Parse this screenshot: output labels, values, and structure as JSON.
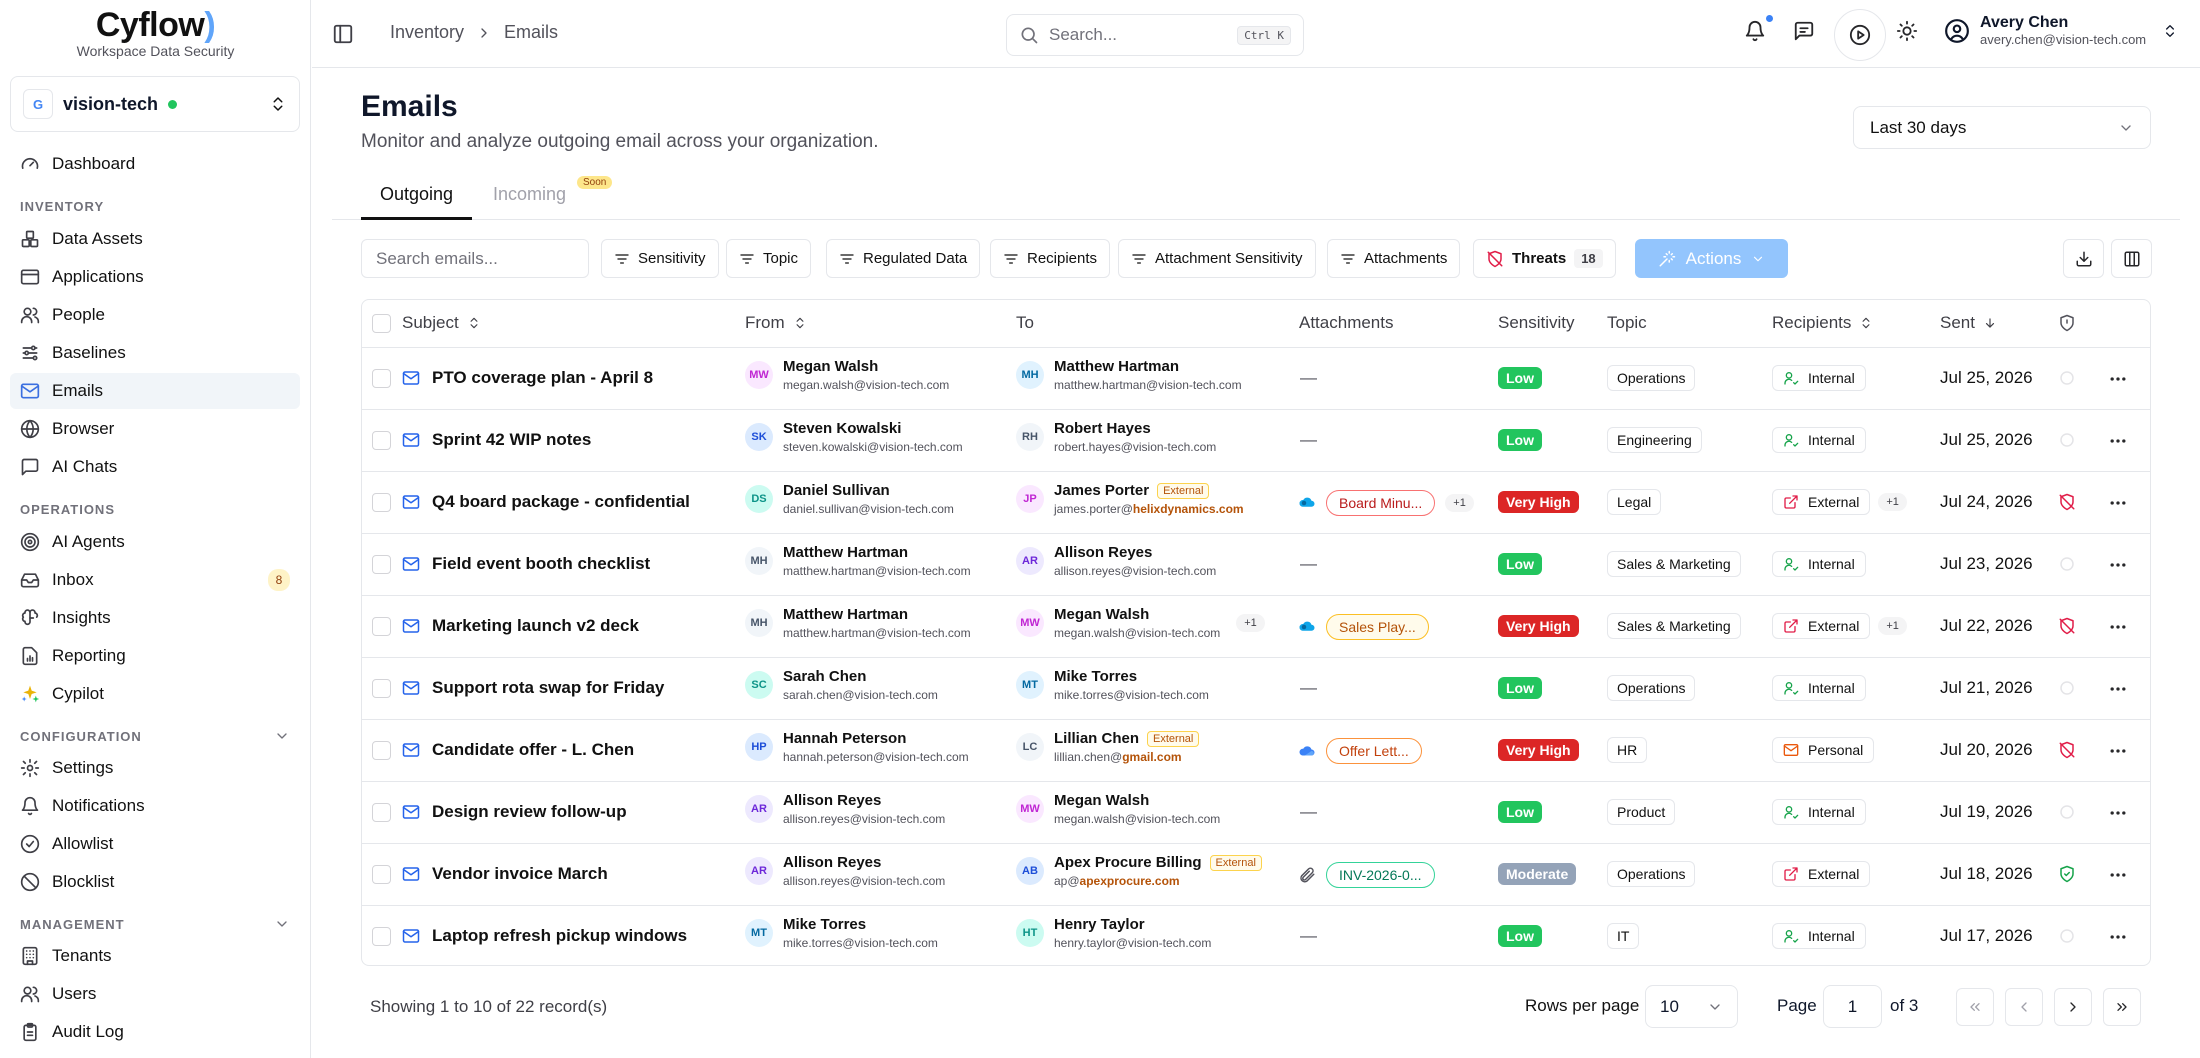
{
  "brand": {
    "name_main": "Cyflow",
    "name_tail": ")",
    "tagline": "Workspace Data Security"
  },
  "tenant": {
    "logo": "G",
    "name": "vision-tech",
    "status_color": "#22c55e"
  },
  "nav": {
    "dashboard": "Dashboard",
    "inventory_label": "INVENTORY",
    "data_assets": "Data Assets",
    "applications": "Applications",
    "people": "People",
    "baselines": "Baselines",
    "emails": "Emails",
    "browser": "Browser",
    "ai_chats": "AI Chats",
    "operations_label": "OPERATIONS",
    "ai_agents": "AI Agents",
    "inbox": "Inbox",
    "inbox_badge": "8",
    "insights": "Insights",
    "reporting": "Reporting",
    "cypilot": "Cypilot",
    "configuration_label": "CONFIGURATION",
    "settings": "Settings",
    "notifications": "Notifications",
    "allowlist": "Allowlist",
    "blocklist": "Blocklist",
    "management_label": "MANAGEMENT",
    "tenants": "Tenants",
    "users": "Users",
    "audit_log": "Audit Log"
  },
  "topbar": {
    "breadcrumb": [
      "Inventory",
      "Emails"
    ],
    "search_placeholder": "Search...",
    "search_shortcut": "Ctrl K",
    "user_name": "Avery Chen",
    "user_email": "avery.chen@vision-tech.com"
  },
  "header": {
    "title": "Emails",
    "subtitle": "Monitor and analyze outgoing email across your organization.",
    "date_range": "Last 30 days",
    "tabs": {
      "outgoing": "Outgoing",
      "incoming": "Incoming",
      "incoming_badge": "Soon"
    }
  },
  "filters": {
    "search_placeholder": "Search emails...",
    "sensitivity": "Sensitivity",
    "topic": "Topic",
    "regulated": "Regulated Data",
    "recipients": "Recipients",
    "attachment_sensitivity": "Attachment Sensitivity",
    "attachments": "Attachments",
    "threats": "Threats",
    "threats_count": "18",
    "actions": "Actions"
  },
  "columns": {
    "subject": "Subject",
    "from": "From",
    "to": "To",
    "attachments": "Attachments",
    "sensitivity": "Sensitivity",
    "topic": "Topic",
    "recipients": "Recipients",
    "sent": "Sent"
  },
  "colors": {
    "low": "#22c55e",
    "very_high": "#dc2626",
    "moderate": "#94a3b8",
    "threat": "#e11d48",
    "safe": "#16a34a",
    "accent": "#2563eb"
  },
  "rows": [
    {
      "subject": "PTO coverage plan - April 8",
      "from": {
        "initials": "MW",
        "name": "Megan Walsh",
        "email": "megan.walsh@vision-tech.com",
        "color": "#c026d3",
        "bg": "#fae8ff"
      },
      "to": {
        "initials": "MH",
        "name": "Matthew Hartman",
        "email_user": "matthew.hartman@vision-tech.com",
        "email_domain": "",
        "external": "",
        "plus": "",
        "color": "#0369a1",
        "bg": "#e0f2fe"
      },
      "attachment": "",
      "attachment_plus": "",
      "attachment_icon": "",
      "sensitivity": "Low",
      "sensitivity_level": "low",
      "topic": "Operations",
      "recipients": "Internal",
      "recipients_type": "internal",
      "recipients_plus": "",
      "sent": "Jul 25, 2026",
      "threat": "none"
    },
    {
      "subject": "Sprint 42 WIP notes",
      "from": {
        "initials": "SK",
        "name": "Steven Kowalski",
        "email": "steven.kowalski@vision-tech.com",
        "color": "#1d4ed8",
        "bg": "#dbeafe"
      },
      "to": {
        "initials": "RH",
        "name": "Robert Hayes",
        "email_user": "robert.hayes@vision-tech.com",
        "email_domain": "",
        "external": "",
        "plus": "",
        "color": "#475569",
        "bg": "#f1f5f9"
      },
      "attachment": "",
      "attachment_plus": "",
      "attachment_icon": "",
      "sensitivity": "Low",
      "sensitivity_level": "low",
      "topic": "Engineering",
      "recipients": "Internal",
      "recipients_type": "internal",
      "recipients_plus": "",
      "sent": "Jul 25, 2026",
      "threat": "none"
    },
    {
      "subject": "Q4 board package - confidential",
      "from": {
        "initials": "DS",
        "name": "Daniel Sullivan",
        "email": "daniel.sullivan@vision-tech.com",
        "color": "#0d9488",
        "bg": "#ccfbf1"
      },
      "to": {
        "initials": "JP",
        "name": "James Porter",
        "email_user": "james.porter@",
        "email_domain": "helixdynamics.com",
        "external": "External",
        "plus": "",
        "color": "#c026d3",
        "bg": "#fae8ff"
      },
      "attachment": "Board Minu...",
      "attachment_plus": "+1",
      "attachment_icon": "onedrive",
      "sensitivity": "Very High",
      "sensitivity_level": "very_high",
      "topic": "Legal",
      "recipients": "External",
      "recipients_type": "external",
      "recipients_plus": "+1",
      "sent": "Jul 24, 2026",
      "threat": "threat"
    },
    {
      "subject": "Field event booth checklist",
      "from": {
        "initials": "MH",
        "name": "Matthew Hartman",
        "email": "matthew.hartman@vision-tech.com",
        "color": "#475569",
        "bg": "#f1f5f9"
      },
      "to": {
        "initials": "AR",
        "name": "Allison Reyes",
        "email_user": "allison.reyes@vision-tech.com",
        "email_domain": "",
        "external": "",
        "plus": "",
        "color": "#6d28d9",
        "bg": "#ede9fe"
      },
      "attachment": "",
      "attachment_plus": "",
      "attachment_icon": "",
      "sensitivity": "Low",
      "sensitivity_level": "low",
      "topic": "Sales & Marketing",
      "recipients": "Internal",
      "recipients_type": "internal",
      "recipients_plus": "",
      "sent": "Jul 23, 2026",
      "threat": "none"
    },
    {
      "subject": "Marketing launch v2 deck",
      "from": {
        "initials": "MH",
        "name": "Matthew Hartman",
        "email": "matthew.hartman@vision-tech.com",
        "color": "#475569",
        "bg": "#f1f5f9"
      },
      "to": {
        "initials": "MW",
        "name": "Megan Walsh",
        "email_user": "megan.walsh@vision-tech.com",
        "email_domain": "",
        "external": "",
        "plus": "+1",
        "color": "#c026d3",
        "bg": "#fae8ff"
      },
      "attachment": "Sales Play...",
      "attachment_plus": "",
      "attachment_icon": "onedrive",
      "sensitivity": "Very High",
      "sensitivity_level": "very_high",
      "topic": "Sales & Marketing",
      "recipients": "External",
      "recipients_type": "external",
      "recipients_plus": "+1",
      "sent": "Jul 22, 2026",
      "threat": "threat"
    },
    {
      "subject": "Support rota swap for Friday",
      "from": {
        "initials": "SC",
        "name": "Sarah Chen",
        "email": "sarah.chen@vision-tech.com",
        "color": "#0d9488",
        "bg": "#ccfbf1"
      },
      "to": {
        "initials": "MT",
        "name": "Mike Torres",
        "email_user": "mike.torres@vision-tech.com",
        "email_domain": "",
        "external": "",
        "plus": "",
        "color": "#0369a1",
        "bg": "#e0f2fe"
      },
      "attachment": "",
      "attachment_plus": "",
      "attachment_icon": "",
      "sensitivity": "Low",
      "sensitivity_level": "low",
      "topic": "Operations",
      "recipients": "Internal",
      "recipients_type": "internal",
      "recipients_plus": "",
      "sent": "Jul 21, 2026",
      "threat": "none"
    },
    {
      "subject": "Candidate offer - L. Chen",
      "from": {
        "initials": "HP",
        "name": "Hannah Peterson",
        "email": "hannah.peterson@vision-tech.com",
        "color": "#1d4ed8",
        "bg": "#dbeafe"
      },
      "to": {
        "initials": "LC",
        "name": "Lillian Chen",
        "email_user": "lillian.chen@",
        "email_domain": "gmail.com",
        "external": "External",
        "plus": "",
        "color": "#475569",
        "bg": "#f1f5f9"
      },
      "attachment": "Offer Lett...",
      "attachment_plus": "",
      "attachment_icon": "cloud",
      "sensitivity": "Very High",
      "sensitivity_level": "very_high",
      "topic": "HR",
      "recipients": "Personal",
      "recipients_type": "personal",
      "recipients_plus": "",
      "sent": "Jul 20, 2026",
      "threat": "threat"
    },
    {
      "subject": "Design review follow-up",
      "from": {
        "initials": "AR",
        "name": "Allison Reyes",
        "email": "allison.reyes@vision-tech.com",
        "color": "#6d28d9",
        "bg": "#ede9fe"
      },
      "to": {
        "initials": "MW",
        "name": "Megan Walsh",
        "email_user": "megan.walsh@vision-tech.com",
        "email_domain": "",
        "external": "",
        "plus": "",
        "color": "#c026d3",
        "bg": "#fae8ff"
      },
      "attachment": "",
      "attachment_plus": "",
      "attachment_icon": "",
      "sensitivity": "Low",
      "sensitivity_level": "low",
      "topic": "Product",
      "recipients": "Internal",
      "recipients_type": "internal",
      "recipients_plus": "",
      "sent": "Jul 19, 2026",
      "threat": "none"
    },
    {
      "subject": "Vendor invoice March",
      "from": {
        "initials": "AR",
        "name": "Allison Reyes",
        "email": "allison.reyes@vision-tech.com",
        "color": "#6d28d9",
        "bg": "#ede9fe"
      },
      "to": {
        "initials": "AB",
        "name": "Apex Procure Billing",
        "email_user": "ap@",
        "email_domain": "apexprocure.com",
        "external": "External",
        "plus": "",
        "color": "#1d4ed8",
        "bg": "#dbeafe"
      },
      "attachment": "INV-2026-0...",
      "attachment_plus": "",
      "attachment_icon": "paperclip",
      "sensitivity": "Moderate",
      "sensitivity_level": "moderate",
      "topic": "Operations",
      "recipients": "External",
      "recipients_type": "external",
      "recipients_plus": "",
      "sent": "Jul 18, 2026",
      "threat": "safe"
    },
    {
      "subject": "Laptop refresh pickup windows",
      "from": {
        "initials": "MT",
        "name": "Mike Torres",
        "email": "mike.torres@vision-tech.com",
        "color": "#0369a1",
        "bg": "#e0f2fe"
      },
      "to": {
        "initials": "HT",
        "name": "Henry Taylor",
        "email_user": "henry.taylor@vision-tech.com",
        "email_domain": "",
        "external": "",
        "plus": "",
        "color": "#0d9488",
        "bg": "#ccfbf1"
      },
      "attachment": "",
      "attachment_plus": "",
      "attachment_icon": "",
      "sensitivity": "Low",
      "sensitivity_level": "low",
      "topic": "IT",
      "recipients": "Internal",
      "recipients_type": "internal",
      "recipients_plus": "",
      "sent": "Jul 17, 2026",
      "threat": "none"
    }
  ],
  "footer": {
    "showing": "Showing 1 to 10 of 22 record(s)",
    "rows_per_page_label": "Rows per page",
    "rows_per_page": "10",
    "page_label": "Page",
    "page": "1",
    "of_pages": "of 3"
  }
}
